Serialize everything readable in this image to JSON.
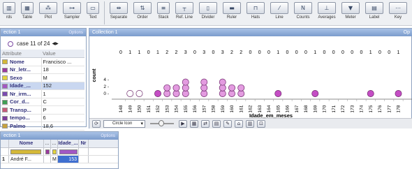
{
  "toolbar": {
    "groups": [
      [
        "rds",
        "Table",
        "Plot",
        "Sampler",
        "Text"
      ],
      [
        "Separate",
        "Order",
        "Stack",
        "Ref. Line",
        "Divider",
        "Ruler",
        "Hats",
        "Line",
        "Counts",
        "Averages",
        "Meter",
        "Label",
        "Key"
      ]
    ]
  },
  "case_card": {
    "title": "ection 1",
    "options": "Options",
    "case_label": "case 11 of 24",
    "nav_arrows": "◀▶",
    "headers": [
      "Attribute",
      "Value"
    ],
    "rows": [
      {
        "name": "Nome",
        "value": "Francisco ...",
        "color": "#d4b838",
        "selected": false
      },
      {
        "name": "Nr_letr...",
        "value": "18",
        "color": "#9b3a9e",
        "selected": false
      },
      {
        "name": "Sexo",
        "value": "M",
        "color": "#e2d33f",
        "selected": false
      },
      {
        "name": "Idade_...",
        "value": "152",
        "color": "#a257c4",
        "selected": true
      },
      {
        "name": "Nr_irm...",
        "value": "1",
        "color": "#7a4ab0",
        "selected": false
      },
      {
        "name": "Cor_d...",
        "value": "C",
        "color": "#3f9f55",
        "selected": false
      },
      {
        "name": "Transp...",
        "value": "P",
        "color": "#c75a7a",
        "selected": false
      },
      {
        "name": "tempo...",
        "value": "6",
        "color": "#7c3c9c",
        "selected": false
      },
      {
        "name": "Palmo",
        "value": "18,6",
        "color": "#c7a23d",
        "selected": false
      }
    ]
  },
  "graph": {
    "title": "Collection 1",
    "options": "Op",
    "select_label": "Circle Icon"
  },
  "chart_data": {
    "type": "scatter",
    "xlabel": "Idade_em_meses",
    "ylabel": "count",
    "categories": [
      "148",
      "149",
      "150",
      "151",
      "152",
      "153",
      "154",
      "155",
      "156",
      "157",
      "158",
      "159",
      "160",
      "161",
      "162",
      "163",
      "164",
      "165",
      "166",
      "167",
      "168",
      "169",
      "170",
      "171",
      "172",
      "173",
      "174",
      "175",
      "176",
      "177",
      "178"
    ],
    "counts": [
      0,
      1,
      1,
      0,
      1,
      2,
      2,
      3,
      0,
      3,
      0,
      3,
      2,
      2,
      0,
      0,
      0,
      1,
      0,
      0,
      0,
      1,
      0,
      0,
      0,
      0,
      0,
      1,
      0,
      0,
      1
    ],
    "count_labels": [
      "0",
      "1",
      "1",
      "0",
      "1",
      "2",
      "3",
      "0",
      "3",
      "0",
      "3",
      "2",
      "2",
      "0",
      "0",
      "0",
      "1",
      "0",
      "0",
      "0",
      "1",
      "0",
      "0",
      "0",
      "0",
      "0",
      "1",
      "0",
      "0",
      "1"
    ],
    "y_ticks": [
      "4 -",
      "2 -",
      "0 -"
    ],
    "highlighted": [
      "149",
      "150"
    ],
    "point_color": "#e39be0",
    "point_stroke": "#6e2a6b",
    "selected_color": "#c44dc4"
  },
  "table": {
    "title": "ection 1",
    "options": "Options",
    "headers": [
      "",
      "Nome",
      "...",
      "...",
      "Idade_...",
      "Nr"
    ],
    "header_colors": [
      "#d4b838",
      "#9b3a9e",
      "#e2d33f",
      "#a257c4"
    ],
    "row": {
      "index": "1",
      "nome": "André F...",
      "c1": "",
      "sexo": "M",
      "idade": "153",
      "nr": ""
    }
  }
}
